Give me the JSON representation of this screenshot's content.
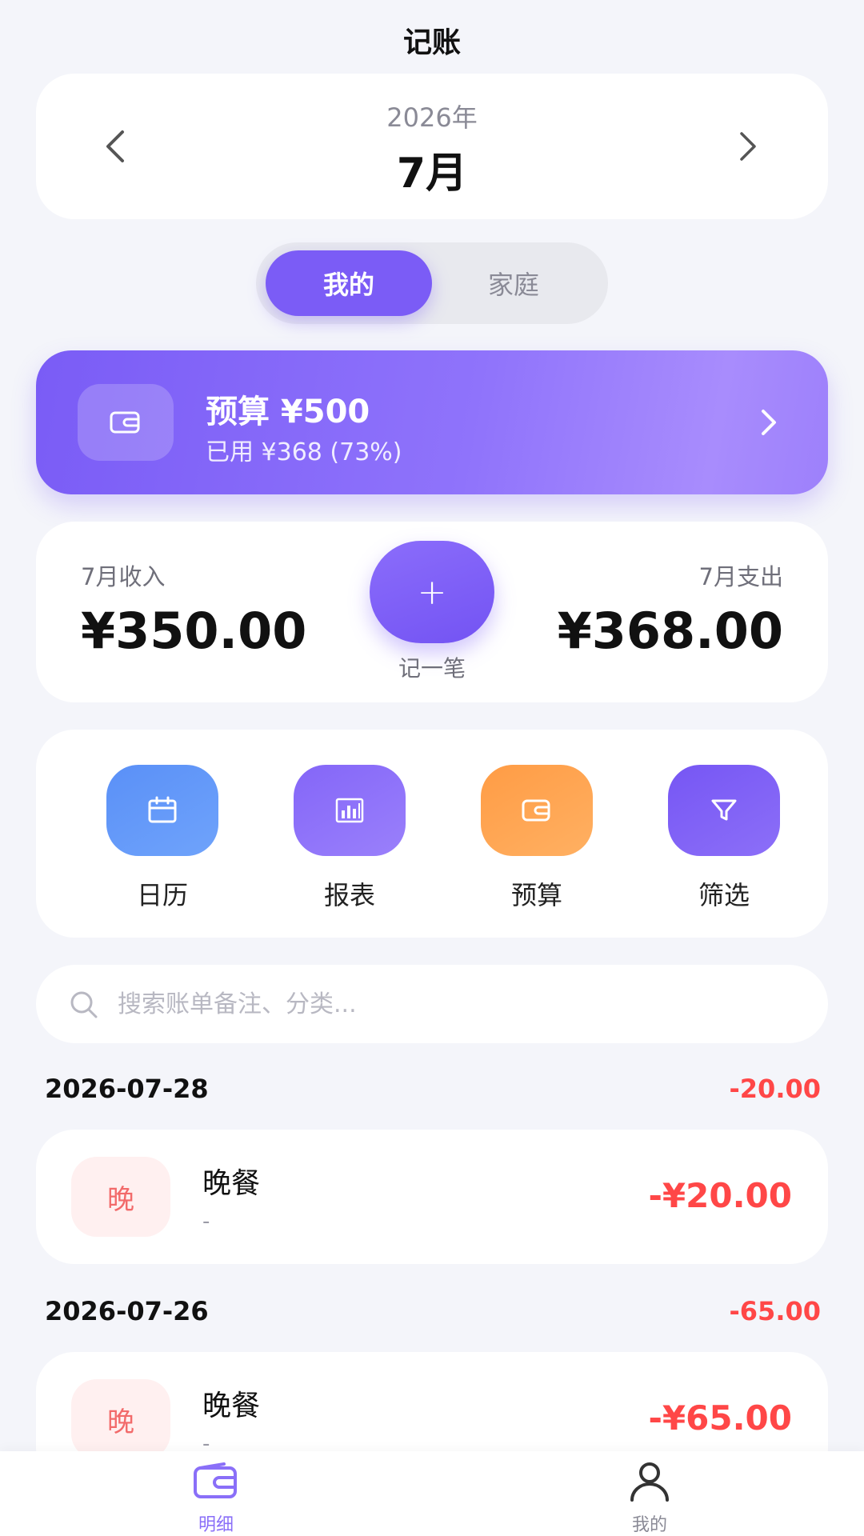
{
  "header": {
    "title": "记账"
  },
  "month_selector": {
    "year": "2026年",
    "month": "7月"
  },
  "segment": {
    "mine": "我的",
    "family": "家庭"
  },
  "budget": {
    "title": "预算 ¥500",
    "subtitle": "已用 ¥368 (73%)"
  },
  "summary": {
    "income_label": "7月收入",
    "income_value": "¥350.00",
    "expense_label": "7月支出",
    "expense_value": "¥368.00",
    "add_symbol": "+",
    "add_label": "记一笔"
  },
  "actions": [
    {
      "label": "日历",
      "icon": "calendar-icon"
    },
    {
      "label": "报表",
      "icon": "bar-chart-icon"
    },
    {
      "label": "预算",
      "icon": "wallet-icon"
    },
    {
      "label": "筛选",
      "icon": "filter-icon"
    }
  ],
  "search": {
    "placeholder": "搜索账单备注、分类..."
  },
  "days": [
    {
      "date": "2026-07-28",
      "total": "-20.00",
      "transactions": [
        {
          "category_char": "晚",
          "name": "晚餐",
          "note": "-",
          "amount": "-¥20.00"
        }
      ]
    },
    {
      "date": "2026-07-26",
      "total": "-65.00",
      "transactions": [
        {
          "category_char": "晚",
          "name": "晚餐",
          "note": "-",
          "amount": "-¥65.00"
        }
      ]
    }
  ],
  "bottom_nav": [
    {
      "label": "明细",
      "icon": "wallet-icon",
      "active": true
    },
    {
      "label": "我的",
      "icon": "person-icon",
      "active": false
    }
  ],
  "colors": {
    "accent": "#7b5cf6",
    "expense_red": "#ff4747",
    "background": "#f4f5fa"
  }
}
